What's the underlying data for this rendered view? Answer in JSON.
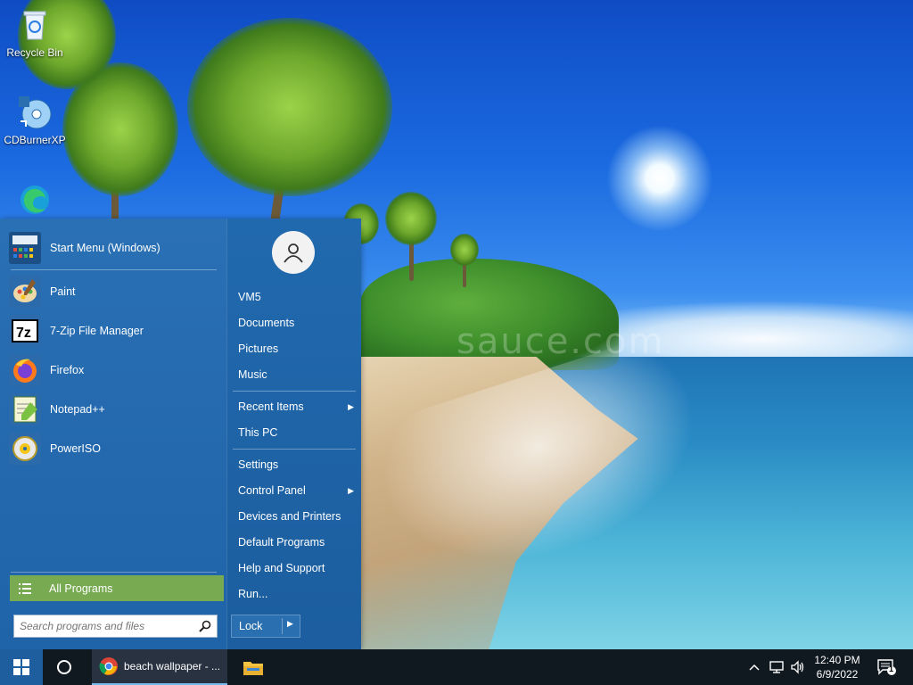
{
  "desktop": {
    "icons": [
      {
        "label": "Recycle Bin",
        "icon": "recycle-bin-icon"
      },
      {
        "label": "CDBurnerXP",
        "icon": "cd-burner-icon"
      },
      {
        "label": "Microsoft Edge",
        "icon": "edge-icon"
      }
    ],
    "watermark": "sauce.com"
  },
  "start_menu": {
    "pinned": [
      {
        "label": "Start Menu (Windows)",
        "icon": "start-menu-icon"
      }
    ],
    "recent": [
      {
        "label": "Paint",
        "icon": "paint-icon"
      },
      {
        "label": "7-Zip File Manager",
        "icon": "7zip-icon"
      },
      {
        "label": "Firefox",
        "icon": "firefox-icon"
      },
      {
        "label": "Notepad++",
        "icon": "notepadpp-icon"
      },
      {
        "label": "PowerISO",
        "icon": "poweriso-icon"
      }
    ],
    "all_programs": "All Programs",
    "search_placeholder": "Search programs and files",
    "right": {
      "user": "VM5",
      "items": [
        "Documents",
        "Pictures",
        "Music"
      ],
      "recent_items": "Recent Items",
      "this_pc": "This PC",
      "settings": "Settings",
      "control_panel": "Control Panel",
      "devices": "Devices and Printers",
      "default_programs": "Default Programs",
      "help": "Help and Support",
      "run": "Run..."
    },
    "lock": "Lock"
  },
  "taskbar": {
    "chrome_title": "beach wallpaper - ...",
    "time": "12:40 PM",
    "date": "6/9/2022",
    "notifications": "1"
  },
  "colors": {
    "menu_bg": "#1f64a9",
    "all_programs_bg": "#78aa52",
    "taskbar_bg": "#101820"
  }
}
